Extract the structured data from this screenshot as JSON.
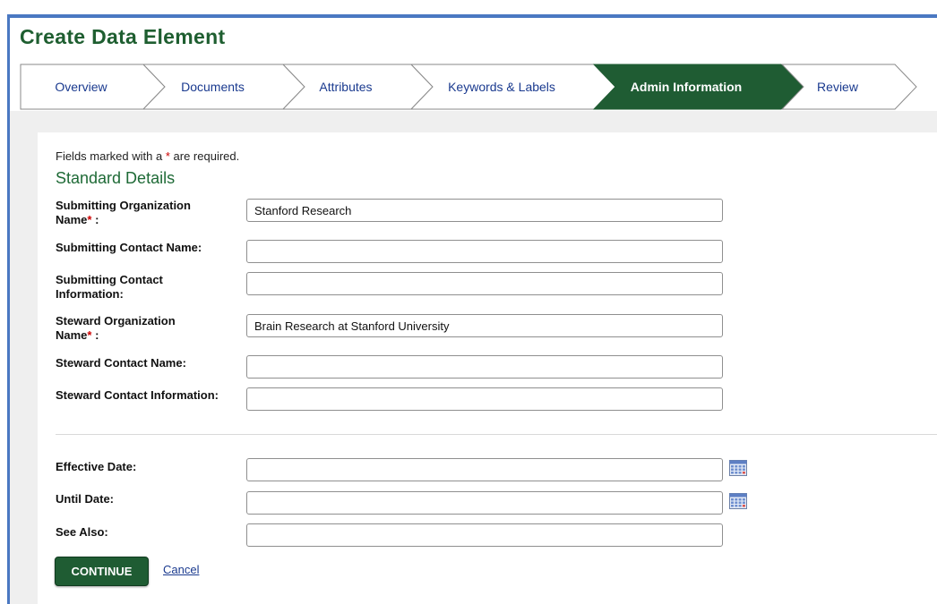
{
  "page": {
    "title": "Create Data Element"
  },
  "colors": {
    "brand_green": "#1e5e30",
    "active_step": "#1f5c33",
    "link_blue": "#1a3a8f",
    "frame_blue": "#4a78c2"
  },
  "wizard": {
    "active_index": 4,
    "steps": [
      {
        "label": "Overview"
      },
      {
        "label": "Documents"
      },
      {
        "label": "Attributes"
      },
      {
        "label": "Keywords & Labels"
      },
      {
        "label": "Admin Information"
      },
      {
        "label": "Review"
      }
    ]
  },
  "form": {
    "required_note_prefix": "Fields marked with a",
    "required_star": "*",
    "required_note_suffix": "are required.",
    "section_title": "Standard Details",
    "fields": {
      "submitting_org": {
        "label_line1": "Submitting Organization",
        "label_line2": "Name",
        "suffix": " :",
        "value": "Stanford Research",
        "placeholder": ""
      },
      "submitting_contact_name": {
        "label": "Submitting Contact Name:",
        "value": "",
        "placeholder": ""
      },
      "submitting_contact_info": {
        "label_line1": "Submitting Contact",
        "label_line2": "Information:",
        "value": "",
        "placeholder": ""
      },
      "steward_org": {
        "label_line1": "Steward Organization",
        "label_line2": "Name",
        "suffix": " :",
        "value": "Brain Research at Stanford University",
        "placeholder": ""
      },
      "steward_contact_name": {
        "label": "Steward Contact Name:",
        "value": "",
        "placeholder": ""
      },
      "steward_contact_info": {
        "label": "Steward Contact Information:",
        "value": "",
        "placeholder": ""
      },
      "effective_date": {
        "label": "Effective Date:",
        "value": "",
        "icon": "calendar-icon"
      },
      "until_date": {
        "label": "Until Date:",
        "value": "",
        "icon": "calendar-icon"
      },
      "see_also": {
        "label": "See Also:",
        "value": ""
      }
    },
    "continue_label": "CONTINUE",
    "cancel_label": "Cancel"
  }
}
